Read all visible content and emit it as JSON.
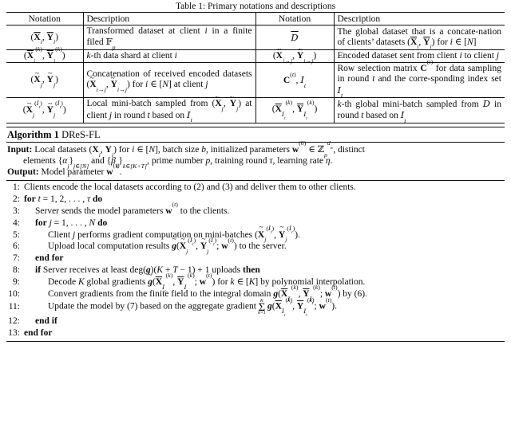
{
  "document": {
    "table": {
      "caption": "Table 1: Primary notations and descriptions",
      "headers": [
        "Notation",
        "Description",
        "Notation",
        "Description"
      ],
      "rows": [
        {
          "left_notation": "(X̄ᵢ, Ȳᵢ)",
          "left_description": "Transformed dataset at client i in a finite filed 𝔽ₚ",
          "right_notation": "D̄",
          "right_description": "The global dataset that is a concatenation of clients' datasets (X̄ᵢ, Ȳᵢ) for i ∈ [N]"
        },
        {
          "left_notation": "(X̄ᵢ⁽ᵏ⁾, Ȳᵢ⁽ᵏ⁾)",
          "left_description": "k-th data shard at client i",
          "right_notation": "(X̃ᵢ→ⱼ, Ỹᵢ→ⱼ)",
          "right_description": "Encoded dataset sent from client i to client j"
        },
        {
          "left_notation": "(X̃ⱼ, Ỹⱼ)",
          "left_description": "Concatenation of received encoded datasets (X̃ᵢ→ⱼ, Ỹᵢ→ⱼ) for i ∈ [N] at client j",
          "right_notation": "C⁽ᵗ⁾, 𝓘ₜ",
          "right_description": "Row selection matrix C⁽ᵗ⁾ for data sampling in round t and the corresponding index set 𝓘ₜ"
        },
        {
          "left_notation": "(X̃ⱼ^(𝓘ₜ), Ỹⱼ^(𝓘ₜ))",
          "left_description": "Local mini-batch sampled from (X̃ⱼ, Ỹⱼ) at client j in round t based on 𝓘ₜ",
          "right_notation": "(X̄_𝓘ₜ⁽ᵏ⁾, Ȳ_𝓘ₜ⁽ᵏ⁾)",
          "right_description": "k-th global mini-batch sampled from D̄ in round t based on 𝓘ₜ"
        }
      ]
    },
    "algorithm": {
      "title_prefix": "Algorithm 1",
      "title_name": "DReS-FL",
      "input_label": "Input:",
      "input_text_line1": "Local datasets (Xᵢ, Yᵢ) for i ∈ [N], batch size b, initialized parameters w⁽⁰⁾ ∈ ℤₚ^{d_w}, distinct",
      "input_text_line2": "elements {αⱼ}ⱼ∈[N] and {βₖ}ₖ∈[K+T], prime number p, training round τ, learning rate η.",
      "output_label": "Output:",
      "output_text": "Model parameter w⁽τ⁾.",
      "steps": [
        {
          "num": "1:",
          "indent": 0,
          "text": "Clients encode the local datasets according to (2) and (3) and deliver them to other clients."
        },
        {
          "num": "2:",
          "indent": 0,
          "text": "for t = 1, 2, . . . , τ do"
        },
        {
          "num": "3:",
          "indent": 1,
          "text": "Server sends the model parameters w⁽ᵗ⁾ to the clients."
        },
        {
          "num": "4:",
          "indent": 1,
          "text": "for j = 1, . . . , N do"
        },
        {
          "num": "5:",
          "indent": 2,
          "text": "Client j performs gradient computation on mini-batches (X̃ⱼ^(𝓘ₜ), Ỹⱼ^(𝓘ₜ))."
        },
        {
          "num": "6:",
          "indent": 2,
          "text": "Upload local computation results g̃(X̃ⱼ^(𝓘ₜ), Ỹⱼ^(𝓘ₜ); w⁽ᵗ⁾) to the server."
        },
        {
          "num": "7:",
          "indent": 1,
          "text": "end for"
        },
        {
          "num": "8:",
          "indent": 1,
          "text": "if Server receives at least deg(g)(K + T − 1) + 1 uploads then"
        },
        {
          "num": "9:",
          "indent": 2,
          "text": "Decode K global gradients g̃(X̄_𝓘ₜ⁽ᵏ⁾, Ȳ_𝓘ₜ⁽ᵏ⁾; w⁽ᵗ⁾) for k ∈ [K] by polynomial interpolation."
        },
        {
          "num": "10:",
          "indent": 2,
          "text": "Convert gradients from the finite field to the integral domain g(X̄_𝓘ₜ⁽ᵏ⁾, Ȳ_𝓘ₜ⁽ᵏ⁾; w⁽ᵗ⁾) by (6)."
        },
        {
          "num": "11:",
          "indent": 2,
          "text": "Update the model by (7) based on the aggregate gradient Σ(k=1..K) g(X̄_𝓘ₜ⁽ᵏ⁾, Ȳ_𝓘ₜ⁽ᵏ⁾; w⁽ᵗ⁾)."
        },
        {
          "num": "12:",
          "indent": 1,
          "text": "end if"
        },
        {
          "num": "13:",
          "indent": 0,
          "text": "end for"
        }
      ]
    }
  },
  "colors": {
    "text": "#0a0a0a",
    "rule": "#111111",
    "background": "#ffffff"
  }
}
